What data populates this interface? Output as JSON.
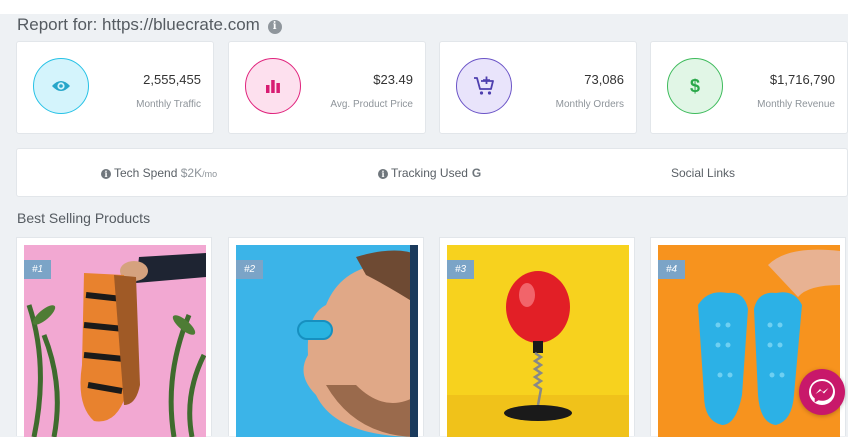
{
  "report": {
    "prefix": "Report for:",
    "url": "https://bluecrate.com",
    "info_glyph": "i"
  },
  "stats": [
    {
      "value": "2,555,455",
      "label": "Monthly Traffic",
      "icon": "eye-icon",
      "color": "#27c2e6"
    },
    {
      "value": "$23.49",
      "label": "Avg. Product Price",
      "icon": "bar-chart-icon",
      "color": "#e0247d"
    },
    {
      "value": "73,086",
      "label": "Monthly Orders",
      "icon": "cart-plus-icon",
      "color": "#6b54c7"
    },
    {
      "value": "$1,716,790",
      "label": "Monthly Revenue",
      "icon": "dollar-icon",
      "color": "#3ebb5c"
    }
  ],
  "info_bar": {
    "tech_label": "Tech Spend",
    "tech_value": "$2K",
    "tech_unit": "/mo",
    "tracking_label": "Tracking Used",
    "tracking_icon_glyph": "G",
    "social_label": "Social Links",
    "info_glyph": "i"
  },
  "best_selling": {
    "title": "Best Selling Products",
    "products": [
      {
        "rank": "#1",
        "background": "#f2a8d2"
      },
      {
        "rank": "#2",
        "background": "#3bb4e8"
      },
      {
        "rank": "#3",
        "background": "#f7d21e"
      },
      {
        "rank": "#4",
        "background": "#f7931e"
      }
    ]
  },
  "messenger": {
    "icon": "messenger-icon"
  }
}
